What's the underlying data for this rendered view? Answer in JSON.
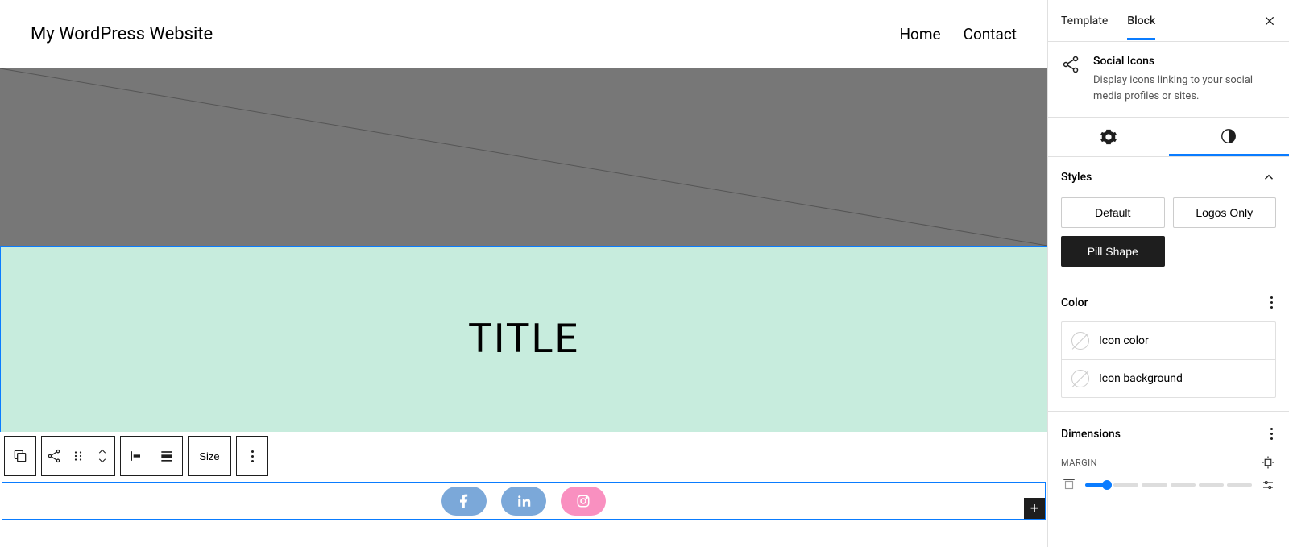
{
  "header": {
    "site_title": "My WordPress Website",
    "nav": {
      "home": "Home",
      "contact": "Contact"
    }
  },
  "content": {
    "title": "TITLE"
  },
  "toolbar": {
    "size_label": "Size"
  },
  "social": {
    "icons": [
      "facebook",
      "linkedin",
      "instagram"
    ]
  },
  "sidebar": {
    "tabs": {
      "template": "Template",
      "block": "Block"
    },
    "block": {
      "name": "Social Icons",
      "description": "Display icons linking to your social media profiles or sites."
    },
    "styles": {
      "heading": "Styles",
      "options": {
        "default": "Default",
        "logos_only": "Logos Only",
        "pill_shape": "Pill Shape"
      }
    },
    "color": {
      "heading": "Color",
      "icon_color": "Icon color",
      "icon_background": "Icon background"
    },
    "dimensions": {
      "heading": "Dimensions",
      "margin_label": "MARGIN"
    }
  }
}
